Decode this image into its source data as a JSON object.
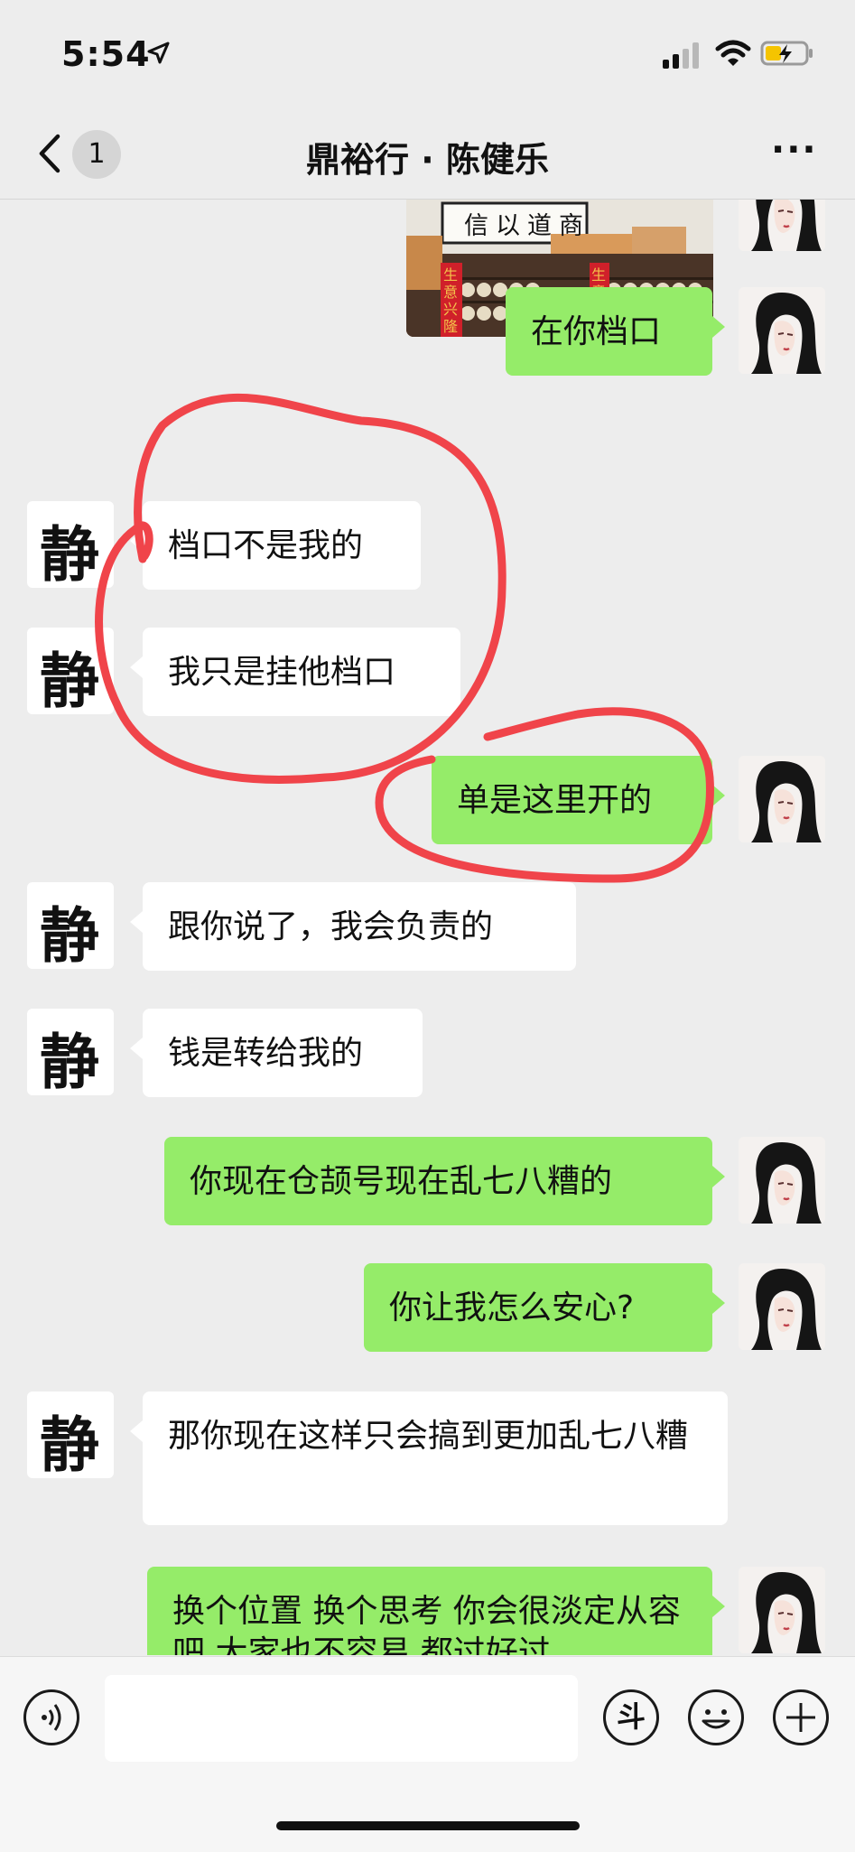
{
  "status_bar": {
    "time": "5:54"
  },
  "nav": {
    "back_count": "1",
    "title": "鼎裕行 · 陈健乐",
    "more": "···"
  },
  "photo": {
    "sign_text": "信以道商",
    "banner_left": "生意兴隆",
    "banner_right": "生意兴隆"
  },
  "avatars": {
    "jing_char": "静"
  },
  "messages": [
    {
      "side": "out",
      "text": "在你档口"
    },
    {
      "side": "in",
      "text": "档口不是我的"
    },
    {
      "side": "in",
      "text": "我只是挂他档口"
    },
    {
      "side": "out",
      "text": "单是这里开的"
    },
    {
      "side": "in",
      "text": "跟你说了，我会负责的"
    },
    {
      "side": "in",
      "text": "钱是转给我的"
    },
    {
      "side": "out",
      "text": "你现在仓颉号现在乱七八糟的"
    },
    {
      "side": "out",
      "text": "你让我怎么安心?"
    },
    {
      "side": "in",
      "text": "那你现在这样只会搞到更加乱七八糟"
    },
    {
      "side": "out",
      "text": "换个位置 换个思考 你会很淡定从容吧 大家也不容易 都过好过"
    }
  ],
  "input_bar": {
    "douyin_icon": "斗",
    "icons": [
      "voice-icon",
      "douyin-icon",
      "emoji-icon",
      "plus-icon"
    ]
  },
  "colors": {
    "background": "#ededed",
    "bubble_out": "#95ec69",
    "bubble_in": "#ffffff",
    "annotation": "#f0444a"
  }
}
